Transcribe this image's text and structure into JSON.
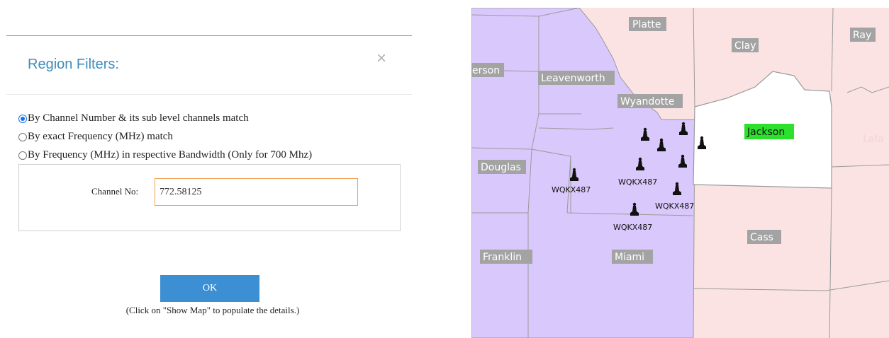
{
  "dialog": {
    "title": "Region Filters:",
    "close_glyph": "×",
    "filters": [
      {
        "label": "By Channel Number & its sub level channels match",
        "selected": true
      },
      {
        "label": "By exact Frequency (MHz) match",
        "selected": false
      },
      {
        "label": "By Frequency (MHz) in respective Bandwidth (Only for 700 Mhz)",
        "selected": false
      }
    ],
    "channel_label": "Channel No:",
    "channel_value": "772.58125",
    "ok_label": "OK",
    "hint": "(Click on \"Show Map\" to populate the details.)"
  },
  "map": {
    "colors": {
      "kansas": "#d9c8fb",
      "missouri": "#fbe3e3",
      "highlight": "#ffffff",
      "county_label_bg": "#a3a3a3",
      "highlight_label_bg": "#2de02d",
      "border": "#9a9a9a"
    },
    "counties": {
      "platte": "Platte",
      "clay": "Clay",
      "ray": "Ray",
      "jefferson": "erson",
      "leavenworth": "Leavenworth",
      "wyandotte": "Wyandotte",
      "jackson": "Jackson",
      "douglas": "Douglas",
      "cass": "Cass",
      "franklin": "Franklin",
      "miami": "Miami",
      "lafayette": "Lafa"
    },
    "station_icon": "radio-tower-icon",
    "station_labels": [
      "WQKX487",
      "WQKX487",
      "WQKX487",
      "WQKX487"
    ]
  }
}
